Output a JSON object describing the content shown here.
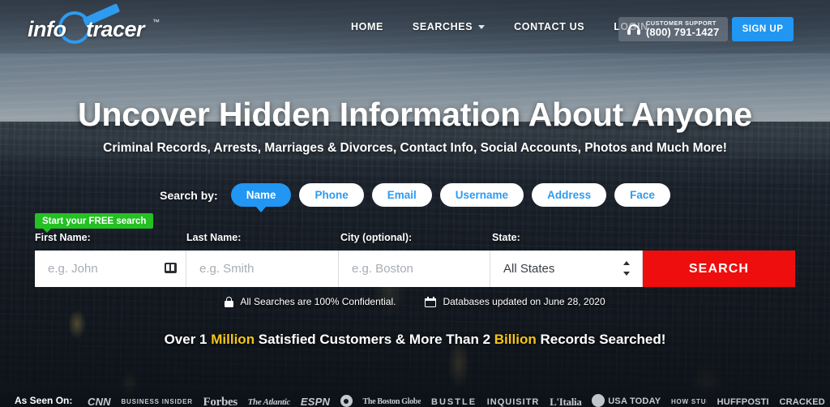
{
  "brand": {
    "name_part1": "info",
    "name_part2": "tracer",
    "trademark": "™",
    "logo_icon": "magnifying-glass-icon",
    "accent_blue": "#2196f3"
  },
  "header": {
    "nav": [
      {
        "label": "HOME",
        "has_chevron": false
      },
      {
        "label": "SEARCHES",
        "has_chevron": true
      },
      {
        "label": "CONTACT US",
        "has_chevron": false
      },
      {
        "label": "LOGIN",
        "has_chevron": false
      }
    ],
    "support": {
      "icon": "headset-icon",
      "label": "CUSTOMER SUPPORT",
      "phone": "(800) 791-1427"
    },
    "signup_label": "SIGN UP"
  },
  "hero": {
    "headline": "Uncover Hidden Information About Anyone",
    "subheadline": "Criminal Records, Arrests, Marriages & Divorces, Contact Info, Social Accounts, Photos and Much More!"
  },
  "search_by": {
    "label": "Search by:",
    "options": [
      {
        "label": "Name",
        "active": true
      },
      {
        "label": "Phone",
        "active": false
      },
      {
        "label": "Email",
        "active": false
      },
      {
        "label": "Username",
        "active": false
      },
      {
        "label": "Address",
        "active": false
      },
      {
        "label": "Face",
        "active": false
      }
    ]
  },
  "form": {
    "free_badge": "Start your FREE search",
    "fields": {
      "first_name": {
        "label": "First Name:",
        "placeholder": "e.g. John",
        "value": "",
        "icon": "keyboard-icon"
      },
      "last_name": {
        "label": "Last Name:",
        "placeholder": "e.g. Smith",
        "value": ""
      },
      "city": {
        "label": "City (optional):",
        "placeholder": "e.g. Boston",
        "value": ""
      },
      "state": {
        "label": "State:",
        "selected": "All States",
        "options": [
          "All States"
        ]
      }
    },
    "submit_label": "SEARCH",
    "submit_color": "#ee0e0e"
  },
  "trust": {
    "confidential": {
      "icon": "lock-icon",
      "text": "All Searches are 100% Confidential."
    },
    "updated": {
      "icon": "calendar-icon",
      "text": "Databases updated on June 28, 2020"
    }
  },
  "stats": {
    "part1": "Over ",
    "num1": "1",
    "hl1": "Million",
    "part2": " Satisfied Customers & More Than ",
    "num2": "2",
    "hl2": "Billion",
    "part3": " Records Searched!",
    "highlight_color": "#f5c518"
  },
  "as_seen_on": {
    "label": "As Seen On:",
    "logos": [
      "CNN",
      "BUSINESS INSIDER",
      "Forbes",
      "The Atlantic",
      "ESPN",
      "CBS",
      "The Boston Globe",
      "BUSTLE",
      "INQUISITR",
      "L'Italia",
      "USA TODAY",
      "HOW STUFF WORKS",
      "HUFFPOSTI",
      "CRACKED"
    ]
  }
}
